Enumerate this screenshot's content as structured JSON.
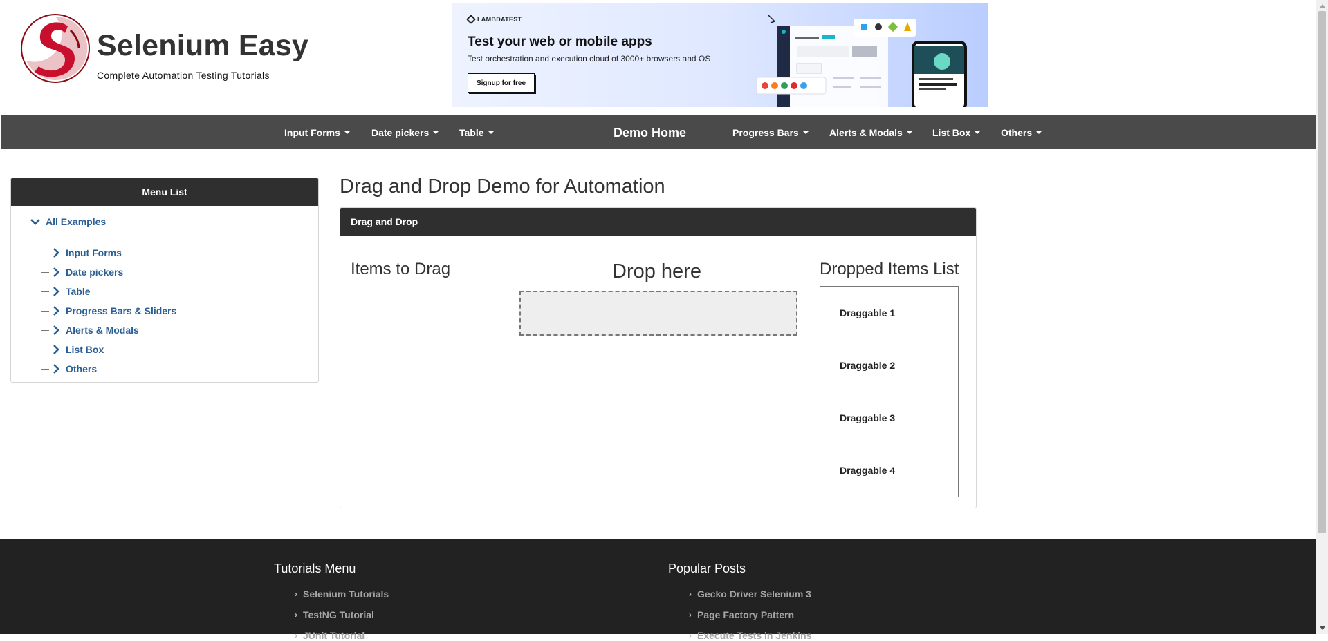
{
  "brand": {
    "title": "Selenium Easy",
    "subtitle": "Complete Automation Testing Tutorials"
  },
  "ad": {
    "logo": "LAMBDATEST",
    "headline": "Test your web or mobile apps",
    "text": "Test orchestration and execution cloud of 3000+ browsers and OS",
    "button": "Signup for free"
  },
  "nav": {
    "left": [
      "Input Forms",
      "Date pickers",
      "Table"
    ],
    "home": "Demo Home",
    "right": [
      "Progress Bars",
      "Alerts & Modals",
      "List Box",
      "Others"
    ]
  },
  "sidebar": {
    "title": "Menu List",
    "root": "All Examples",
    "items": [
      "Input Forms",
      "Date pickers",
      "Table",
      "Progress Bars & Sliders",
      "Alerts & Modals",
      "List Box",
      "Others"
    ]
  },
  "main": {
    "title": "Drag and Drop Demo for Automation",
    "panel_title": "Drag and Drop",
    "items_to_drag": "Items to Drag",
    "drop_here": "Drop here",
    "dropped_list": "Dropped Items List",
    "draggables": [
      "Draggable 1",
      "Draggable 2",
      "Draggable 3",
      "Draggable 4"
    ]
  },
  "footer": {
    "tutorials_title": "Tutorials Menu",
    "tutorials": [
      "Selenium Tutorials",
      "TestNG Tutorial",
      "JUnit Tutorial"
    ],
    "popular_title": "Popular Posts",
    "popular": [
      "Gecko Driver Selenium 3",
      "Page Factory Pattern",
      "Execute Tests in Jenkins"
    ]
  },
  "colors": {
    "navbar": "#4a4a4a",
    "panel_header": "#2f2f2f",
    "link": "#2a5f95",
    "footer": "#222222",
    "logo_red": "#c8102e"
  }
}
